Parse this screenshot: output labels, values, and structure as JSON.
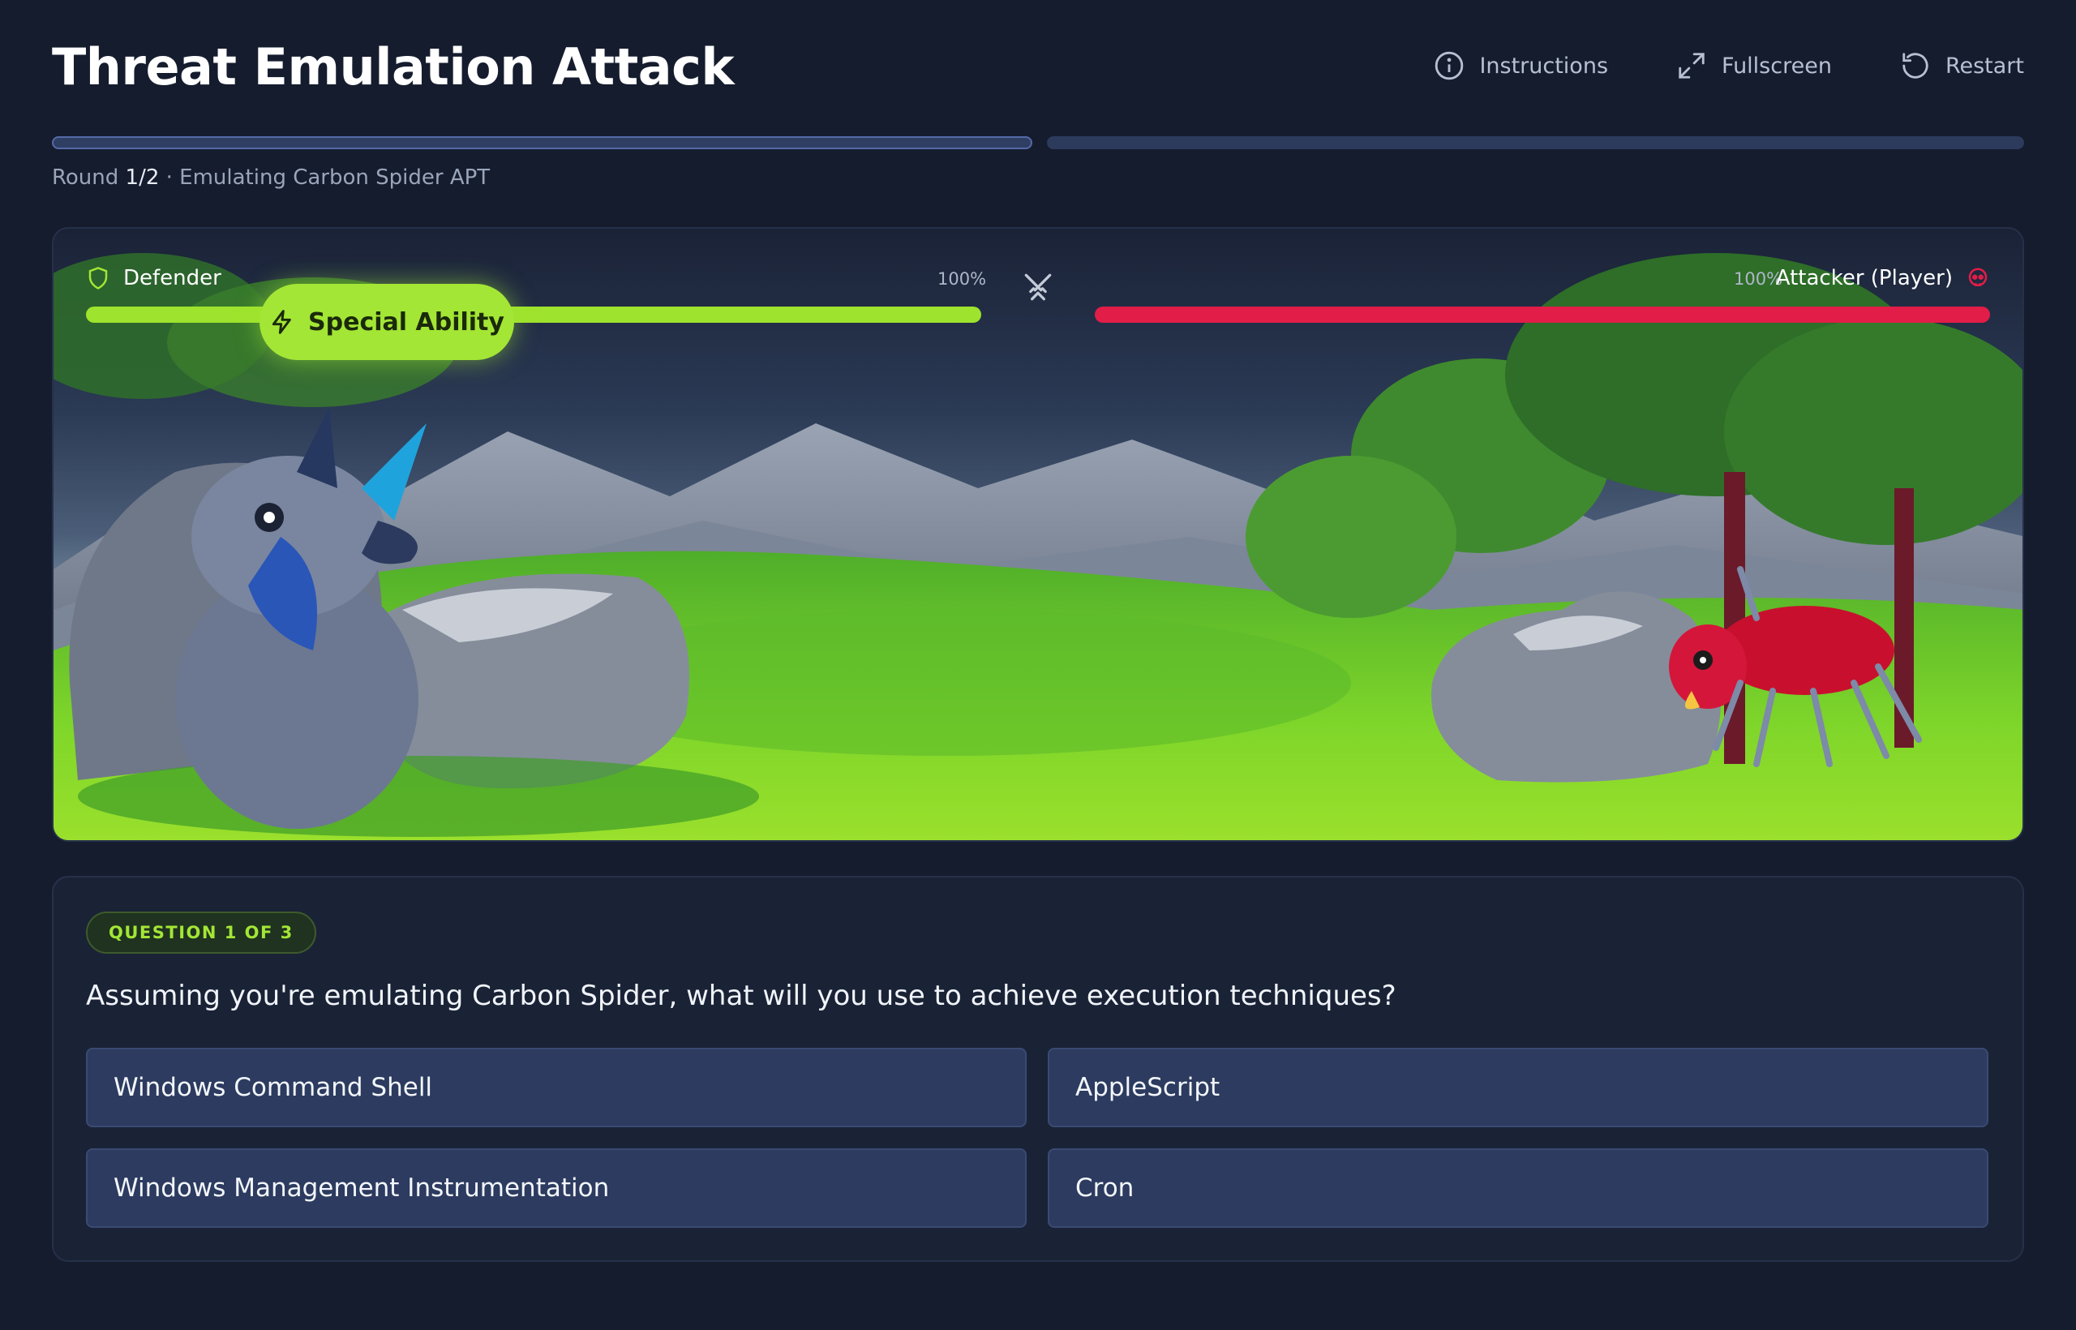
{
  "header": {
    "title": "Threat Emulation Attack",
    "instructions_label": "Instructions",
    "fullscreen_label": "Fullscreen",
    "restart_label": "Restart"
  },
  "progress": {
    "round_word": "Round",
    "round_value": "1/2",
    "round_suffix": "· Emulating Carbon Spider APT",
    "segments_total": 2,
    "segments_active": 1
  },
  "arena": {
    "defender": {
      "label": "Defender",
      "health_pct": "100%",
      "health_fraction": 1.0,
      "color": "#9ee32d",
      "icon": "shield-icon"
    },
    "attacker": {
      "label": "Attacker (Player)",
      "health_pct": "100%",
      "health_fraction": 1.0,
      "color": "#e11d48",
      "icon": "skull-icon"
    },
    "special_ability_label": "Special Ability",
    "versus_icon": "crossed-swords-icon"
  },
  "quiz": {
    "badge": "QUESTION 1 OF 3",
    "question": "Assuming you're emulating Carbon Spider, what will you use to achieve execution techniques?",
    "answers": [
      "Windows Command Shell",
      "AppleScript",
      "Windows Management Instrumentation",
      "Cron"
    ]
  },
  "colors": {
    "background": "#151c2e",
    "accent_green": "#a3e635",
    "attacker_red": "#e11d48",
    "answer_bg": "#2c3b5f"
  }
}
